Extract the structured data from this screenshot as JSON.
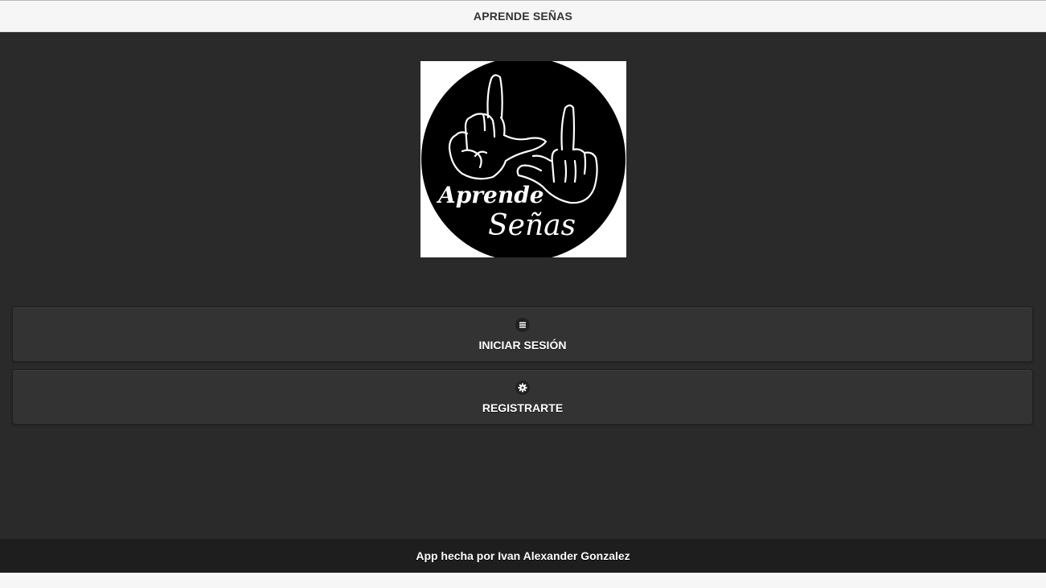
{
  "header": {
    "title": "APRENDE SEÑAS"
  },
  "logo": {
    "alt": "Aprende Señas logo",
    "text_line1": "Aprende",
    "text_line2": "Señas"
  },
  "menu": {
    "items": [
      {
        "label": "INICIAR SESIÓN",
        "icon": "bars-icon"
      },
      {
        "label": "REGISTRARTE",
        "icon": "gear-icon"
      }
    ]
  },
  "footer": {
    "text": "App hecha por Ivan Alexander Gonzalez"
  },
  "colors": {
    "header_bg": "#f6f6f6",
    "content_bg": "#2a2a2a",
    "button_bg": "#333333",
    "footer_bg": "#1e1e1e",
    "text_light": "#ffffff",
    "text_dark": "#333333"
  }
}
